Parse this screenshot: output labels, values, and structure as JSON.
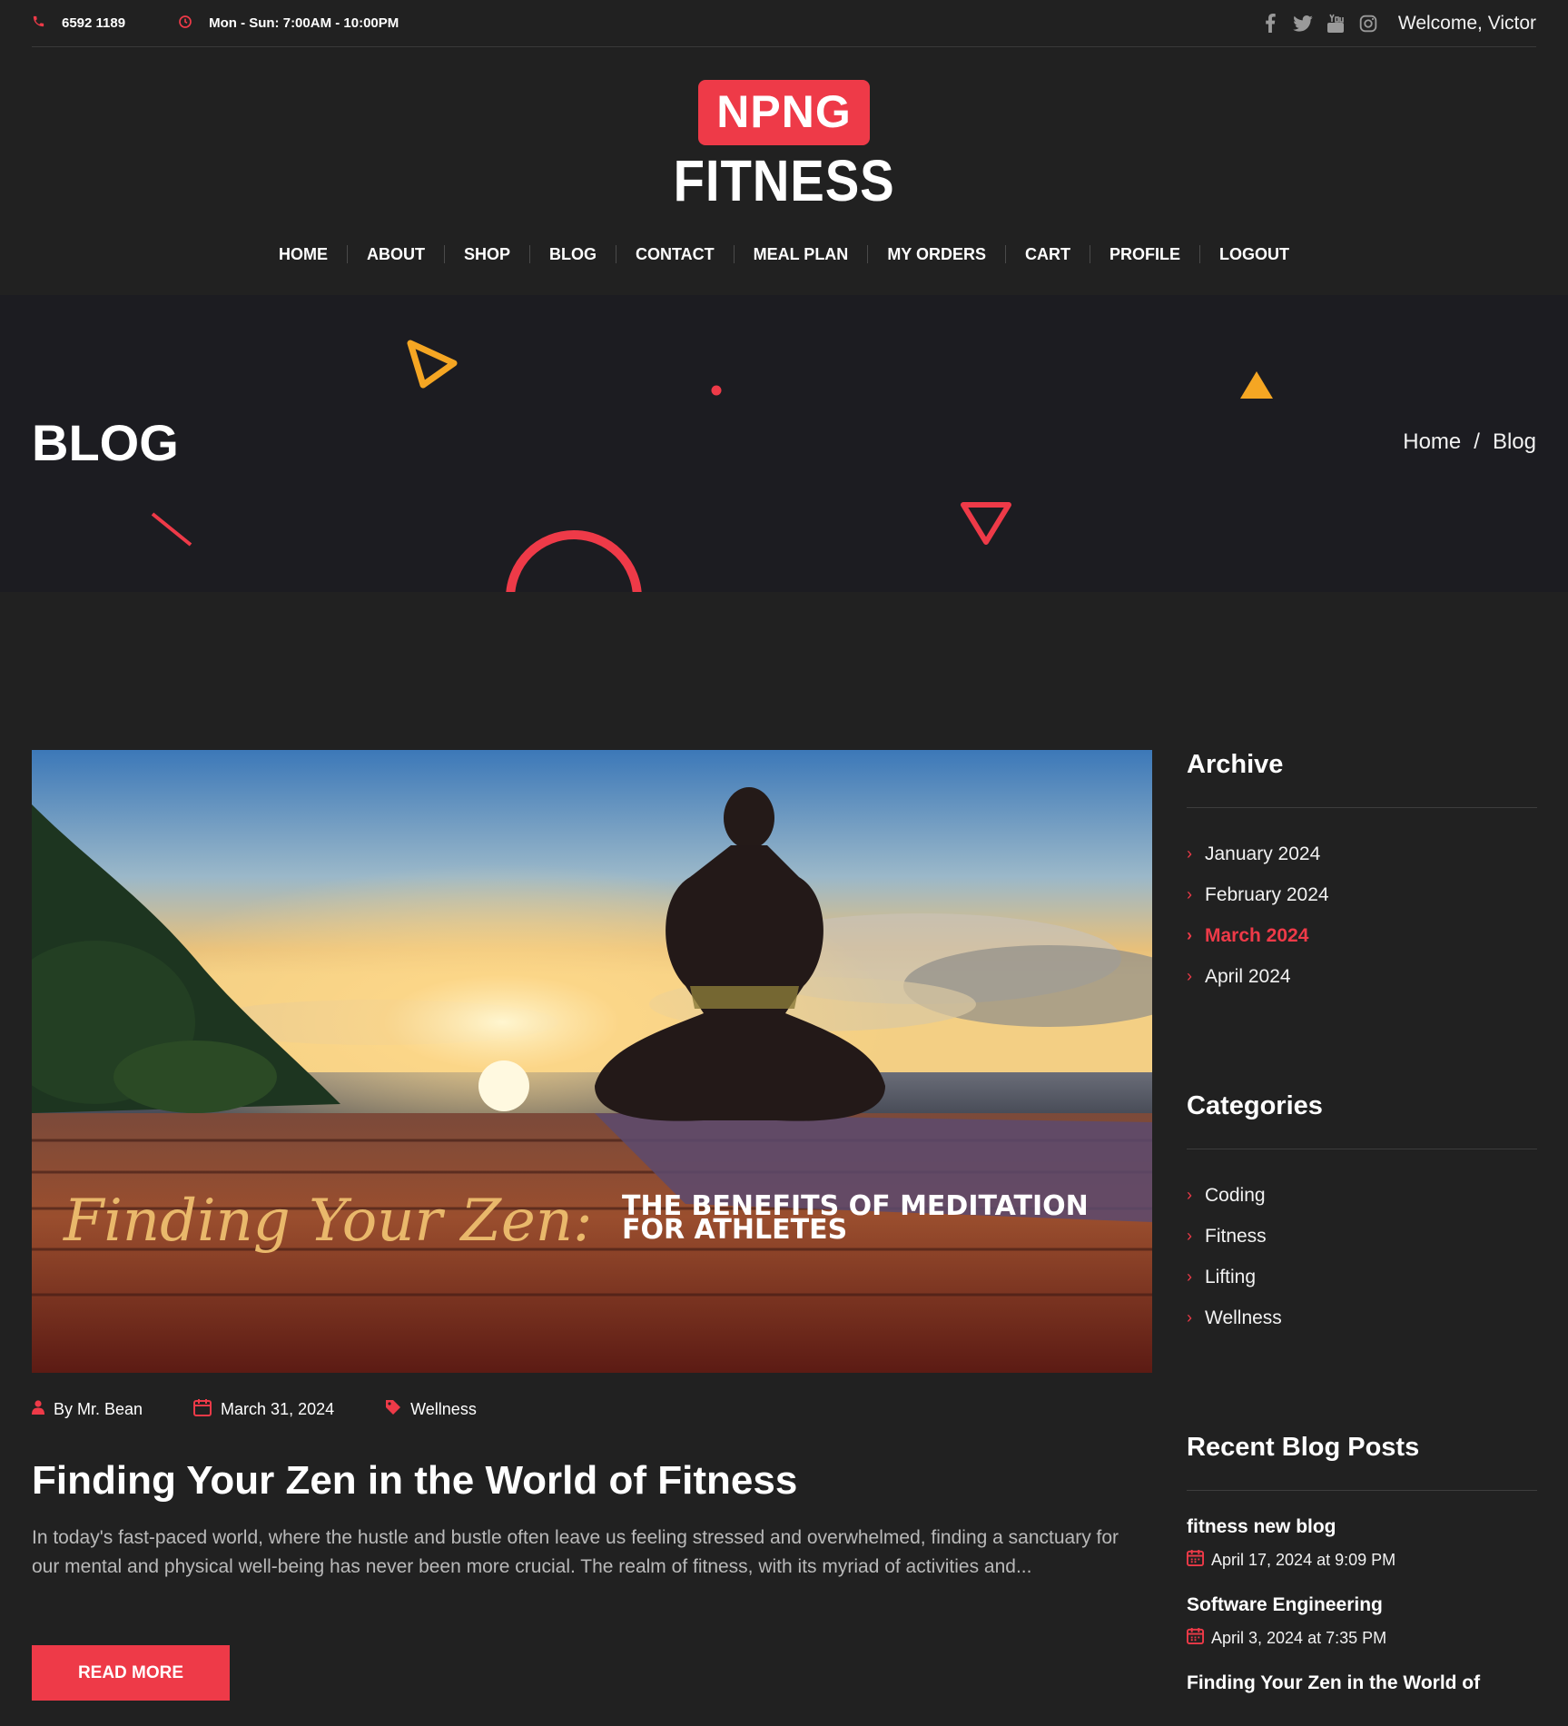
{
  "topbar": {
    "phone": "6592 1189",
    "hours": "Mon - Sun: 7:00AM - 10:00PM",
    "welcome": "Welcome, Victor"
  },
  "logo": {
    "badge": "NPNG",
    "word": "FITNESS"
  },
  "nav": {
    "items": [
      "HOME",
      "ABOUT",
      "SHOP",
      "BLOG",
      "CONTACT",
      "MEAL PLAN",
      "MY ORDERS",
      "CART",
      "PROFILE",
      "LOGOUT"
    ]
  },
  "banner": {
    "title": "BLOG",
    "breadcrumb": {
      "home": "Home",
      "separator": "/",
      "current": "Blog"
    }
  },
  "post": {
    "image_text": {
      "script": "Finding Your Zen:",
      "line1": "THE BENEFITS OF MEDITATION",
      "line2": "FOR ATHLETES"
    },
    "author": "By Mr. Bean",
    "date": "March 31, 2024",
    "category": "Wellness",
    "title": "Finding Your Zen in the World of Fitness",
    "excerpt": "In today's fast-paced world, where the hustle and bustle often leave us feeling stressed and overwhelmed, finding a sanctuary for our mental and physical well-being has never been more crucial. The realm of fitness, with its myriad of activities and...",
    "read_more": "READ MORE"
  },
  "sidebar": {
    "archive": {
      "title": "Archive",
      "items": [
        "January 2024",
        "February 2024",
        "March 2024",
        "April 2024"
      ],
      "active": "March 2024"
    },
    "categories": {
      "title": "Categories",
      "items": [
        "Coding",
        "Fitness",
        "Lifting",
        "Wellness"
      ]
    },
    "recent": {
      "title": "Recent Blog Posts",
      "items": [
        {
          "title": "fitness new blog",
          "date": "April 17, 2024 at 9:09 PM"
        },
        {
          "title": "Software Engineering",
          "date": "April 3, 2024 at 7:35 PM"
        },
        {
          "title": "Finding Your Zen in the World of",
          "date": ""
        }
      ]
    }
  },
  "colors": {
    "accent": "#ee3a48",
    "deco_orange": "#f5a623",
    "background": "#212121",
    "banner_bg": "#1c1c21"
  },
  "icons": [
    "phone-icon",
    "clock-icon",
    "facebook-icon",
    "twitter-icon",
    "youtube-icon",
    "instagram-icon",
    "user-icon",
    "calendar-icon",
    "tag-icon",
    "chevron-right-icon"
  ]
}
